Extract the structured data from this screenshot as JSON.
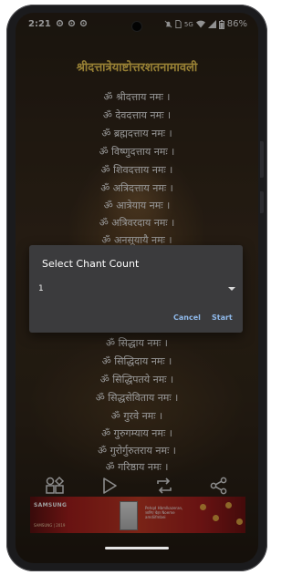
{
  "status_bar": {
    "time": "2:21",
    "notification_icons": [
      "settings-icon",
      "settings-icon",
      "settings-icon"
    ],
    "right_icons": [
      "notifications-off-icon",
      "sim-icon",
      "wifi-icon",
      "signal-icon",
      "battery-icon"
    ],
    "network_label": "5G",
    "battery": "86%"
  },
  "page": {
    "title": "श्रीदत्तात्रेयाष्टोत्तरशतनामावली",
    "verses": [
      "ॐ श्रीदत्ताय नमः ।",
      "ॐ देवदत्ताय नमः ।",
      "ॐ ब्रह्मदत्ताय नमः ।",
      "ॐ विष्णुदत्ताय नमः ।",
      "ॐ शिवदत्ताय नमः ।",
      "ॐ अत्रिदत्ताय नमः ।",
      "ॐ आत्रेयाय नमः ।",
      "ॐ अत्रिवरदाय नमः ।",
      "ॐ अनसूयायै नमः ।",
      "ॐ सिद्धाय नमः ।",
      "ॐ सिद्धिदाय नमः ।",
      "ॐ सिद्धिपतये नमः ।",
      "ॐ सिद्धसेविताय नमः ।",
      "ॐ गुरवे नमः ।",
      "ॐ गुरुगम्याय नमः ।",
      "ॐ गुरोर्गुरुतराय नमः ।",
      "ॐ गरिष्ठाय नमः ।"
    ]
  },
  "dialog": {
    "title": "Select Chant Count",
    "selected_value": "1",
    "cancel_label": "Cancel",
    "start_label": "Start"
  },
  "toolbar": {
    "icons": [
      "apps-icon",
      "play-icon",
      "repeat-icon",
      "share-icon"
    ]
  },
  "ad": {
    "brand": "SAMSUNG",
    "headline": "Pehqd Hbmlkazeran, जानिए चेहर Noeme amdiifmbei",
    "fine_print": "SAMSUNG | 2019"
  },
  "colors": {
    "title": "#f4cf55",
    "dialog_background": "#3b3b3d",
    "dialog_button": "#8fb9ea",
    "ad_red": "#c53a25"
  }
}
